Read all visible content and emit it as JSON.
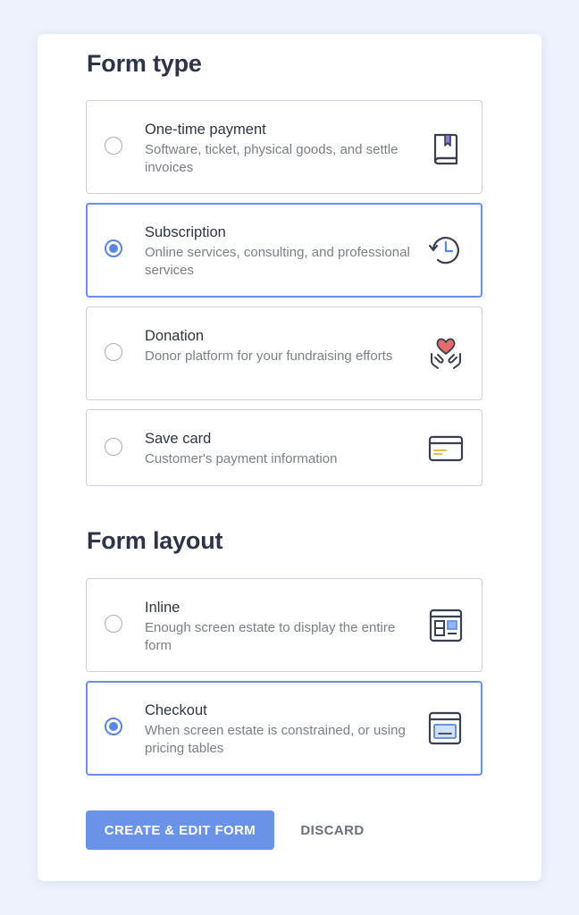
{
  "form_type": {
    "title": "Form type",
    "options": [
      {
        "title": "One-time payment",
        "description": "Software, ticket, physical goods, and settle invoices",
        "icon": "bookmark-book-icon",
        "selected": false
      },
      {
        "title": "Subscription",
        "description": "Online services, consulting, and professional services",
        "icon": "history-clock-icon",
        "selected": true
      },
      {
        "title": "Donation",
        "description": "Donor platform for your fundraising efforts",
        "icon": "heart-hands-icon",
        "selected": false
      },
      {
        "title": "Save card",
        "description": "Customer's payment information",
        "icon": "credit-card-icon",
        "selected": false
      }
    ]
  },
  "form_layout": {
    "title": "Form layout",
    "options": [
      {
        "title": "Inline",
        "description": "Enough screen estate to display the entire form",
        "icon": "inline-layout-icon",
        "selected": false
      },
      {
        "title": "Checkout",
        "description": "When screen estate is constrained, or using pricing tables",
        "icon": "checkout-window-icon",
        "selected": true
      }
    ]
  },
  "actions": {
    "primary_label": "CREATE & EDIT FORM",
    "secondary_label": "DISCARD"
  },
  "colors": {
    "background": "#eef2fd",
    "accent": "#6a93e8",
    "selected_border": "#6a91e5",
    "heart": "#e36b6b",
    "bookmark": "#8e7ad6",
    "card_stripe": "#f0b84a",
    "layout_accent": "#8fb6ef"
  }
}
